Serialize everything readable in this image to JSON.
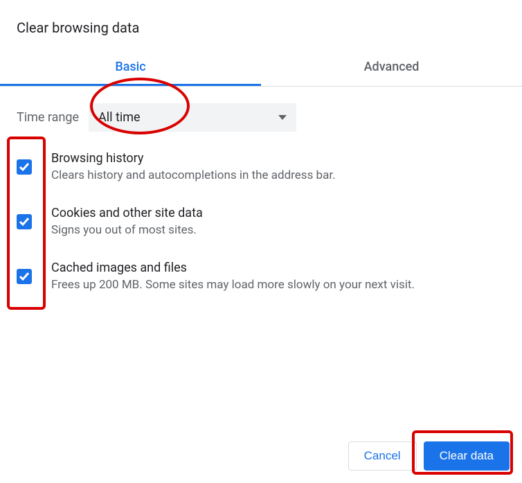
{
  "title": "Clear browsing data",
  "tabs": {
    "basic": "Basic",
    "advanced": "Advanced"
  },
  "timeRange": {
    "label": "Time range",
    "selected": "All time"
  },
  "options": [
    {
      "title": "Browsing history",
      "desc": "Clears history and autocompletions in the address bar.",
      "checked": true
    },
    {
      "title": "Cookies and other site data",
      "desc": "Signs you out of most sites.",
      "checked": true
    },
    {
      "title": "Cached images and files",
      "desc": "Frees up 200 MB. Some sites may load more slowly on your next visit.",
      "checked": true
    }
  ],
  "buttons": {
    "cancel": "Cancel",
    "confirm": "Clear data"
  },
  "colors": {
    "accent": "#1a73e8",
    "annotation": "#d90000"
  }
}
